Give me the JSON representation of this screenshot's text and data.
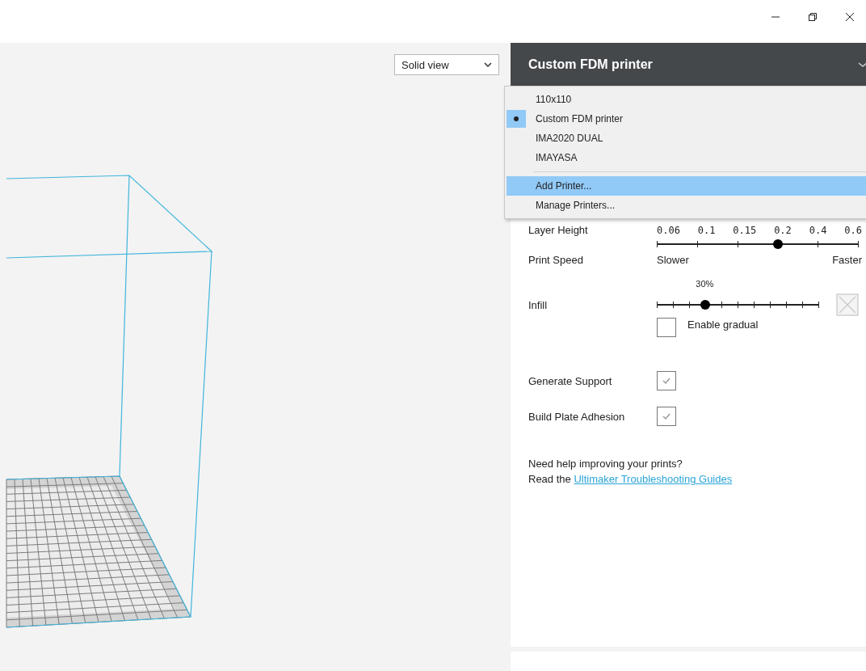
{
  "view_select": {
    "value": "Solid view"
  },
  "printer_header": {
    "title": "Custom FDM printer"
  },
  "printer_menu": {
    "printers": [
      {
        "label": "110x110",
        "selected": false
      },
      {
        "label": "Custom FDM printer",
        "selected": true
      },
      {
        "label": "IMA2020 DUAL",
        "selected": false
      },
      {
        "label": "IMAYASA",
        "selected": false
      }
    ],
    "actions": [
      {
        "label": "Add Printer...",
        "hovered": true
      },
      {
        "label": "Manage Printers...",
        "hovered": false
      }
    ]
  },
  "settings": {
    "layer_height": {
      "label": "Layer Height",
      "ticks": [
        "0.06",
        "0.1",
        "0.15",
        "0.2",
        "0.4",
        "0.6"
      ],
      "level": 0.6
    },
    "print_speed": {
      "label": "Print Speed",
      "left": "Slower",
      "right": "Faster"
    },
    "infill": {
      "label": "Infill",
      "reading": "30%",
      "level": 0.3,
      "gradual": {
        "label": "Enable gradual",
        "checked": false
      }
    },
    "support": {
      "label": "Generate Support",
      "checked": true
    },
    "adhesion": {
      "label": "Build Plate Adhesion",
      "checked": true
    }
  },
  "help": {
    "text": "Need help improving your prints?",
    "prefix": "Read the",
    "link": "Ultimaker Troubleshooting Guides"
  }
}
